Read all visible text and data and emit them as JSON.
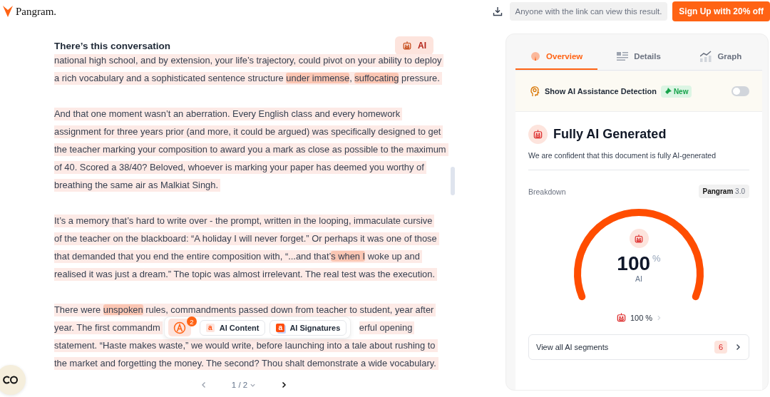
{
  "header": {
    "logo": "Pangram.",
    "share_note": "Anyone with the link can view this result.",
    "signup_button": "Sign Up with 20% off"
  },
  "document": {
    "title": "There’s this conversation",
    "badge": "AI",
    "paragraphs": [
      {
        "lines": [
          [
            {
              "kind": "text",
              "text": "national high school, and by extension, your life’s trajectory, could pivot on your ability to deploy"
            }
          ],
          [
            {
              "kind": "text",
              "text": "a rich vocabulary and a sophisticated sentence structure "
            },
            {
              "kind": "highlight",
              "text": "under immense"
            },
            {
              "kind": "text",
              "text": ", "
            },
            {
              "kind": "highlight",
              "text": "suffocating"
            },
            {
              "kind": "text",
              "text": " pressure."
            }
          ]
        ]
      },
      {
        "lines": [
          [
            {
              "kind": "text",
              "text": "And that one moment wasn’t an aberration. Every English class and every homework"
            }
          ],
          [
            {
              "kind": "text",
              "text": "assignment for three years prior (and more, it could be argued) was specifically designed to get"
            }
          ],
          [
            {
              "kind": "text",
              "text": "the teacher marking your composition to award you a mark as close as possible to the maximum"
            }
          ],
          [
            {
              "kind": "text",
              "text": "of 40. Scored a 38/40? Beloved, whoever is marking your paper has deemed you worthy of"
            }
          ],
          [
            {
              "kind": "text",
              "text": "breathing the same air as Malkiat Singh."
            }
          ]
        ]
      },
      {
        "lines": [
          [
            {
              "kind": "text",
              "text": "It’s a memory that’s hard to write over - the prompt, written in the looping, immaculate cursive"
            }
          ],
          [
            {
              "kind": "text",
              "text": "of the teacher on the blackboard: “A holiday I will never forget.” Or perhaps it was one of those"
            }
          ],
          [
            {
              "kind": "text",
              "text": "that demanded that you end the entire composition with, “...and that’"
            },
            {
              "kind": "highlight",
              "text": "s when I"
            },
            {
              "kind": "text",
              "text": " woke up and"
            }
          ],
          [
            {
              "kind": "text",
              "text": "realised it was just a dream.” The topic was almost irrelevant. The real test was the execution."
            }
          ]
        ]
      },
      {
        "lines": [
          [
            {
              "kind": "text",
              "text": "There were "
            },
            {
              "kind": "highlight",
              "text": "unspoken"
            },
            {
              "kind": "text",
              "text": " rules, commandments passed down from teacher to student, year after"
            }
          ],
          [
            {
              "kind": "text",
              "text": "year. The first commandm"
            },
            {
              "kind": "gap"
            },
            {
              "kind": "text",
              "text": "erful opening"
            }
          ],
          [
            {
              "kind": "text",
              "text": "statement. “Haste makes waste,” we would write, before launching into a tale about rushing to"
            }
          ],
          [
            {
              "kind": "text",
              "text": "the market and forgetting the money. The second? Thou shalt demonstrate a wide vocabulary."
            }
          ]
        ]
      }
    ],
    "toolbar": {
      "count": "2",
      "buttons": [
        {
          "icon": "a",
          "label": "AI Content"
        },
        {
          "icon": "a",
          "label": "AI Signatures"
        }
      ]
    },
    "pagination": {
      "page": "1 / 2"
    }
  },
  "panel": {
    "tabs": [
      {
        "label": "Overview",
        "selected": true
      },
      {
        "label": "Details",
        "selected": false
      },
      {
        "label": "Graph",
        "selected": false
      }
    ],
    "assist": {
      "label": "Show AI Assistance Detection",
      "tag": "New",
      "on": false
    },
    "verdict": {
      "title": "Fully AI Generated",
      "description": "We are confident that this document is fully AI-generated"
    },
    "breakdown": {
      "label": "Breakdown",
      "model_name": "Pangram",
      "model_version": "3.0"
    },
    "gauge": {
      "value": "100",
      "unit": "%",
      "label": "AI"
    },
    "summary": "100 %",
    "segments_link": {
      "label": "View all AI segments",
      "count": "6"
    }
  }
}
